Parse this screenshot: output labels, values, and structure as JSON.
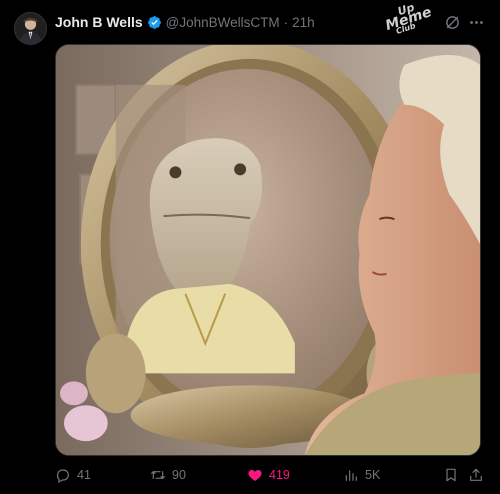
{
  "tweet": {
    "author_name": "John B Wells",
    "handle": "@JohnBWellsCTM",
    "separator": "·",
    "time": "21h",
    "verified": true,
    "watermark": {
      "line1": "Up",
      "line2": "Meme",
      "line3": "Club"
    },
    "media": {
      "description_icon": "photo"
    },
    "actions": {
      "replies": "41",
      "reposts": "90",
      "likes": "419",
      "views": "5K"
    }
  },
  "colors": {
    "background": "#000000",
    "text_primary": "#e7e9ea",
    "text_secondary": "#71767b",
    "verified_blue": "#1d9bf0",
    "like_pink": "#f91880"
  },
  "icons": [
    "avatar",
    "verified-badge-icon",
    "grok-icon",
    "more-icon",
    "reply-icon",
    "retweet-icon",
    "heart-icon",
    "views-icon",
    "bookmark-icon",
    "share-icon"
  ]
}
